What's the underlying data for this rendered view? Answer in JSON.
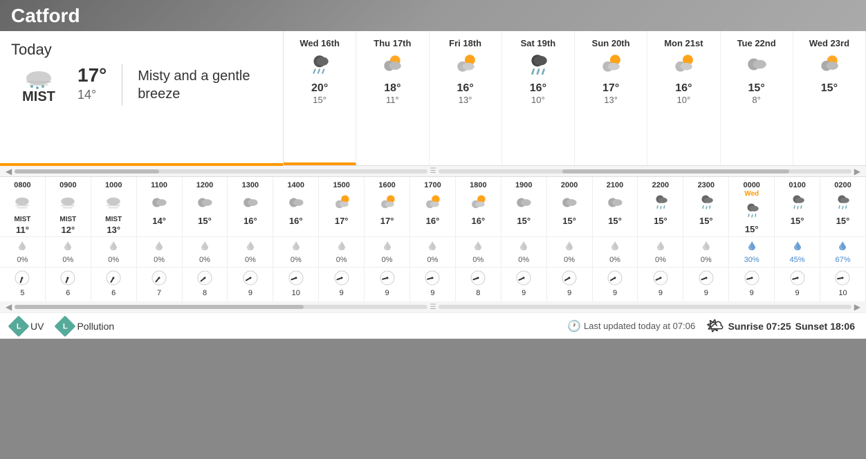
{
  "location": "Catford",
  "today": {
    "label": "Today",
    "condition": "MIST",
    "high": "17°",
    "low": "14°",
    "description": "Misty and a gentle breeze",
    "icon": "mist"
  },
  "forecast": [
    {
      "day": "Wed 16th",
      "icon": "rain",
      "high": "20°",
      "low": "15°",
      "active": true
    },
    {
      "day": "Thu 17th",
      "icon": "partly-cloudy",
      "high": "18°",
      "low": "11°",
      "active": false
    },
    {
      "day": "Fri 18th",
      "icon": "sunny-cloud",
      "high": "16°",
      "low": "13°",
      "active": false
    },
    {
      "day": "Sat 19th",
      "icon": "rain-cloud",
      "high": "16°",
      "low": "10°",
      "active": false
    },
    {
      "day": "Sun 20th",
      "icon": "sunny-cloud-2",
      "high": "17°",
      "low": "13°",
      "active": false
    },
    {
      "day": "Mon 21st",
      "icon": "sunny-cloud",
      "high": "16°",
      "low": "10°",
      "active": false
    },
    {
      "day": "Tue 22nd",
      "icon": "cloud",
      "high": "15°",
      "low": "8°",
      "active": false
    },
    {
      "day": "Wed 23rd",
      "icon": "partly-cloudy",
      "high": "15°",
      "low": "",
      "active": false
    }
  ],
  "hours": [
    {
      "label": "0800",
      "sub": "",
      "condition": "MIST",
      "temp": "11°",
      "icon": "mist",
      "rain_pct": "0%",
      "rain_wet": false,
      "wind": 5
    },
    {
      "label": "0900",
      "sub": "",
      "condition": "MIST",
      "temp": "12°",
      "icon": "mist",
      "rain_pct": "0%",
      "rain_wet": false,
      "wind": 6
    },
    {
      "label": "1000",
      "sub": "",
      "condition": "MIST",
      "temp": "13°",
      "icon": "mist",
      "rain_pct": "0%",
      "rain_wet": false,
      "wind": 6
    },
    {
      "label": "1100",
      "sub": "",
      "condition": "",
      "temp": "14°",
      "icon": "cloud",
      "rain_pct": "0%",
      "rain_wet": false,
      "wind": 7
    },
    {
      "label": "1200",
      "sub": "",
      "condition": "",
      "temp": "15°",
      "icon": "cloud",
      "rain_pct": "0%",
      "rain_wet": false,
      "wind": 8
    },
    {
      "label": "1300",
      "sub": "",
      "condition": "",
      "temp": "16°",
      "icon": "cloud",
      "rain_pct": "0%",
      "rain_wet": false,
      "wind": 9
    },
    {
      "label": "1400",
      "sub": "",
      "condition": "",
      "temp": "16°",
      "icon": "cloud",
      "rain_pct": "0%",
      "rain_wet": false,
      "wind": 10
    },
    {
      "label": "1500",
      "sub": "",
      "condition": "",
      "temp": "17°",
      "icon": "sunny-cloud",
      "rain_pct": "0%",
      "rain_wet": false,
      "wind": 9
    },
    {
      "label": "1600",
      "sub": "",
      "condition": "",
      "temp": "17°",
      "icon": "sunny-cloud",
      "rain_pct": "0%",
      "rain_wet": false,
      "wind": 9
    },
    {
      "label": "1700",
      "sub": "",
      "condition": "",
      "temp": "16°",
      "icon": "sunny-cloud",
      "rain_pct": "0%",
      "rain_wet": false,
      "wind": 9
    },
    {
      "label": "1800",
      "sub": "",
      "condition": "",
      "temp": "16°",
      "icon": "sunny-cloud",
      "rain_pct": "0%",
      "rain_wet": false,
      "wind": 8
    },
    {
      "label": "1900",
      "sub": "",
      "condition": "",
      "temp": "15°",
      "icon": "cloud",
      "rain_pct": "0%",
      "rain_wet": false,
      "wind": 9
    },
    {
      "label": "2000",
      "sub": "",
      "condition": "",
      "temp": "15°",
      "icon": "cloud",
      "rain_pct": "0%",
      "rain_wet": false,
      "wind": 9
    },
    {
      "label": "2100",
      "sub": "",
      "condition": "",
      "temp": "15°",
      "icon": "cloud",
      "rain_pct": "0%",
      "rain_wet": false,
      "wind": 9
    },
    {
      "label": "2200",
      "sub": "",
      "condition": "",
      "temp": "15°",
      "icon": "drizzle",
      "rain_pct": "0%",
      "rain_wet": false,
      "wind": 9
    },
    {
      "label": "2300",
      "sub": "",
      "condition": "",
      "temp": "15°",
      "icon": "drizzle",
      "rain_pct": "0%",
      "rain_wet": false,
      "wind": 9
    },
    {
      "label": "0000",
      "sub": "Wed",
      "condition": "",
      "temp": "15°",
      "icon": "drizzle",
      "rain_pct": "30%",
      "rain_wet": true,
      "wind": 9
    },
    {
      "label": "0100",
      "sub": "",
      "condition": "",
      "temp": "15°",
      "icon": "drizzle",
      "rain_pct": "45%",
      "rain_wet": true,
      "wind": 9
    },
    {
      "label": "0200",
      "sub": "",
      "condition": "",
      "temp": "15°",
      "icon": "drizzle",
      "rain_pct": "67%",
      "rain_wet": true,
      "wind": 10
    }
  ],
  "footer": {
    "last_updated": "Last updated today at 07:06",
    "uv_label": "UV",
    "pollution_label": "Pollution",
    "uv_level": "L",
    "pollution_level": "L",
    "sunrise": "Sunrise 07:25",
    "sunset": "Sunset 18:06"
  }
}
